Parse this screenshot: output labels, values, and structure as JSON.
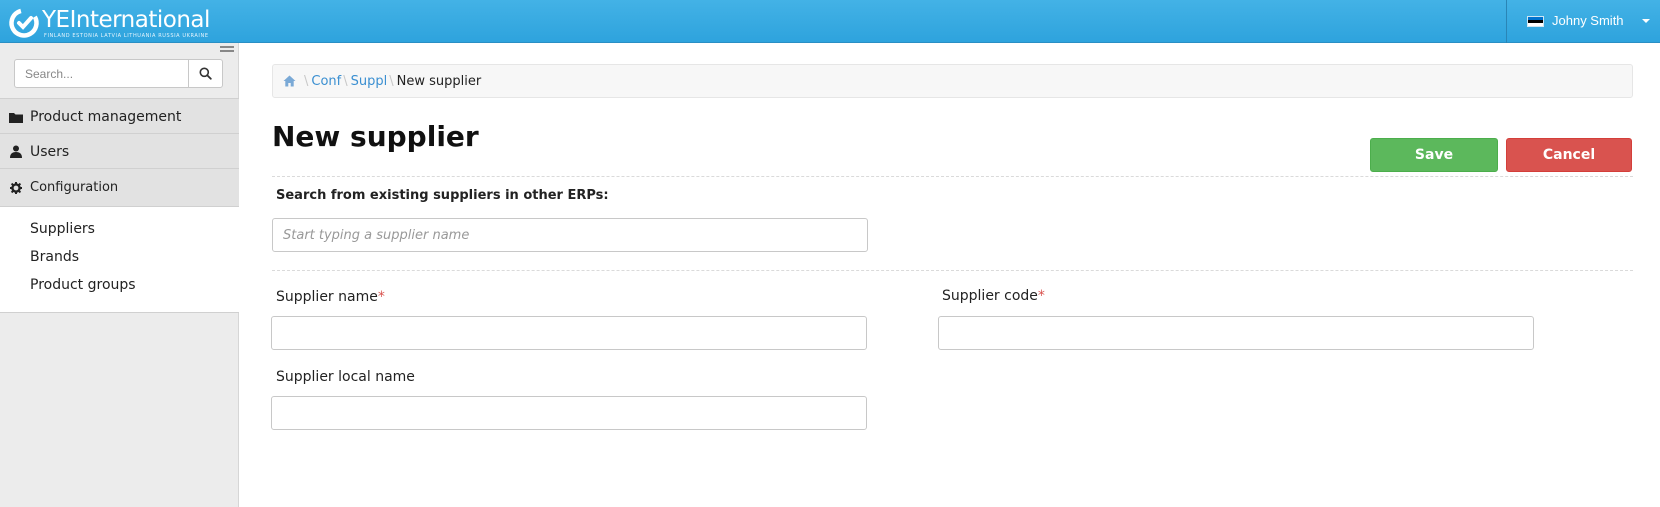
{
  "header": {
    "logo_text": "YEInternational",
    "logo_sub": "FINLAND  ESTONIA  LATVIA  LITHUANIA  RUSSIA  UKRAINE",
    "user_name": "Johny Smith"
  },
  "sidebar": {
    "search_placeholder": "Search...",
    "nav": [
      {
        "label": "Product management",
        "icon": "folder-icon"
      },
      {
        "label": "Users",
        "icon": "user-icon"
      },
      {
        "label": "Configuration",
        "icon": "gear-icon"
      }
    ],
    "subnav": [
      "Suppliers",
      "Brands",
      "Product groups"
    ]
  },
  "breadcrumb": {
    "items": [
      "Conf",
      "Suppl"
    ],
    "current": "New supplier"
  },
  "page": {
    "title": "New supplier",
    "save_label": "Save",
    "cancel_label": "Cancel"
  },
  "form": {
    "search_label": "Search from existing suppliers in other ERPs:",
    "search_placeholder": "Start typing a supplier name",
    "supplier_name_label": "Supplier name",
    "supplier_code_label": "Supplier code",
    "supplier_local_name_label": "Supplier local name",
    "required_mark": "*"
  },
  "colors": {
    "header": "#2ea3dd",
    "save": "#5cb85c",
    "cancel": "#d9534f",
    "link": "#3a8fd1"
  }
}
